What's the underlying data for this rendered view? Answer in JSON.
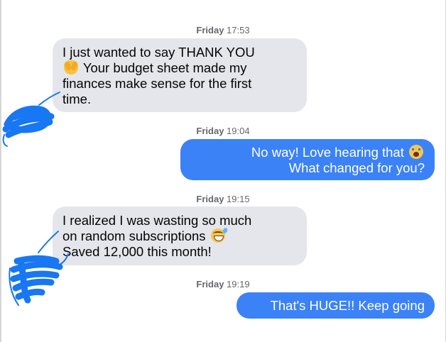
{
  "colors": {
    "incoming_bubble": "#e4e6eb",
    "outgoing_bubble": "#3b82f6",
    "timestamp_text": "#65676b",
    "redaction_scribble": "#1877f2"
  },
  "messages": [
    {
      "day": "Friday",
      "time": "17:53",
      "direction": "incoming",
      "lines": [
        "I just wanted to say THANK YOU",
        "Your budget sheet made my",
        "finances make sense for the first",
        "time."
      ],
      "emoji": "raising-hands-icon"
    },
    {
      "day": "Friday",
      "time": "19:04",
      "direction": "outgoing",
      "lines": [
        "No way! Love hearing that",
        "What changed for you?"
      ],
      "emoji": "face-screaming-icon"
    },
    {
      "day": "Friday",
      "time": "19:15",
      "direction": "incoming",
      "lines": [
        "I realized I was wasting so much",
        "on random subscriptions",
        "Saved 12,000 this month!"
      ],
      "emoji": "grinning-sweat-icon"
    },
    {
      "day": "Friday",
      "time": "19:19",
      "direction": "outgoing",
      "lines": [
        "That's HUGE!! Keep going"
      ]
    }
  ]
}
